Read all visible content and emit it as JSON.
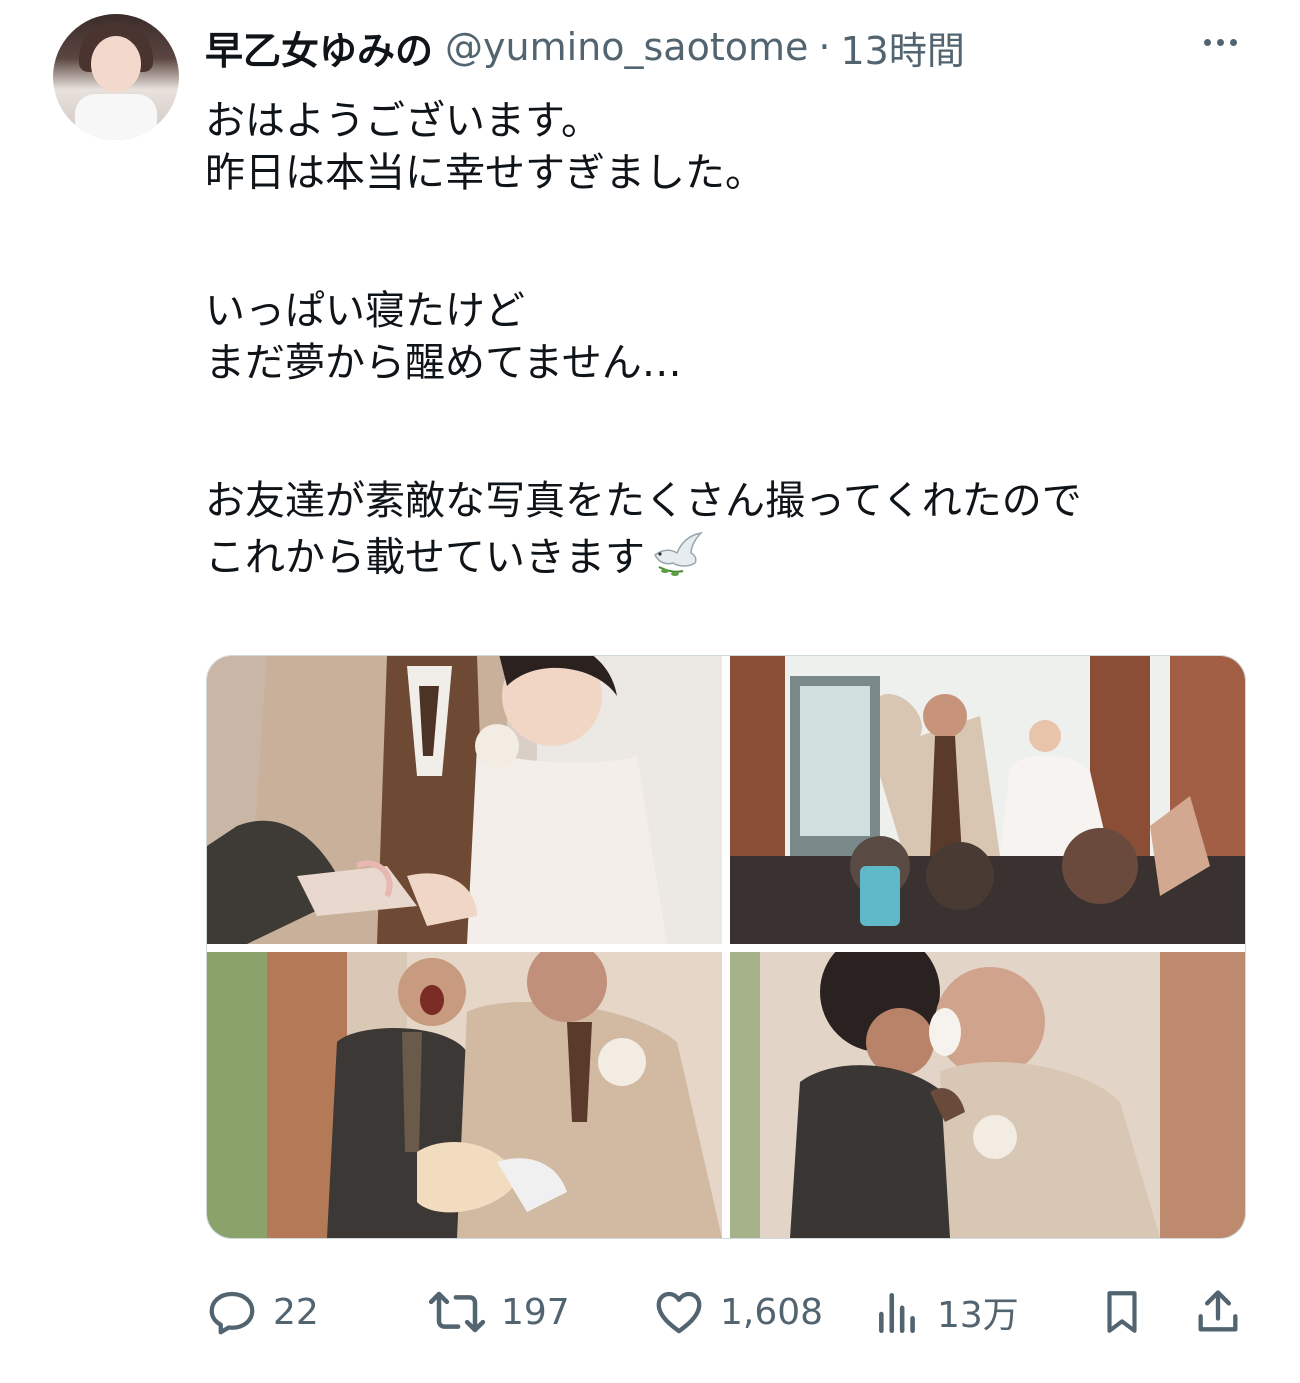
{
  "tweet": {
    "author": {
      "display_name": "早乙女ゆみの",
      "handle": "@yumino_saotome",
      "avatar_icon": "profile-avatar"
    },
    "separator": "·",
    "time": "13時間",
    "text_lines": [
      "おはようございます。",
      "昨日は本当に幸せすぎました。",
      "",
      "いっぱい寝たけど",
      "まだ夢から醒めてません…",
      "",
      "お友達が素敵な写真をたくさん撮ってくれたので",
      "これから載せていきます"
    ],
    "emoji_icon": "dove-icon",
    "media": [
      {
        "icon": "photo-ring-exchange"
      },
      {
        "icon": "photo-couple-entrance"
      },
      {
        "icon": "photo-cake-holding"
      },
      {
        "icon": "photo-cake-smash-hug"
      }
    ],
    "actions": {
      "reply": {
        "icon": "reply-icon",
        "count": "22"
      },
      "retweet": {
        "icon": "retweet-icon",
        "count": "197"
      },
      "like": {
        "icon": "heart-icon",
        "count": "1,608"
      },
      "views": {
        "icon": "views-icon",
        "count": "13万"
      },
      "bookmark": {
        "icon": "bookmark-icon"
      },
      "share": {
        "icon": "share-icon"
      }
    },
    "colors": {
      "text": "#0f1419",
      "secondary": "#536471",
      "border": "#cfd9de"
    }
  }
}
